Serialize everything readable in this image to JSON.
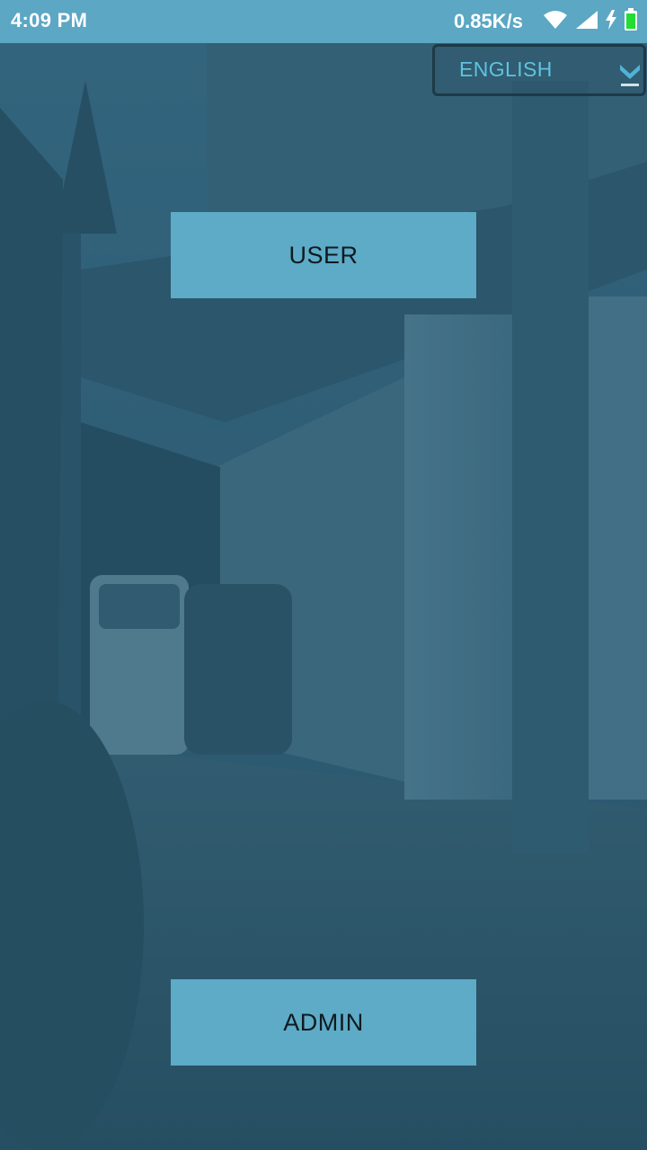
{
  "status_bar": {
    "time": "4:09 PM",
    "net_speed": "0.85K/s",
    "icons": [
      "wifi-icon",
      "signal-icon",
      "charging-icon",
      "battery-icon"
    ]
  },
  "language_selector": {
    "selected": "ENGLISH",
    "icon": "chevron-down-icon"
  },
  "buttons": {
    "user": "USER",
    "admin": "ADMIN"
  },
  "colors": {
    "accent": "#5dabc7",
    "status_bar": "#5ba7c4",
    "language_text": "#5fc3e0"
  }
}
